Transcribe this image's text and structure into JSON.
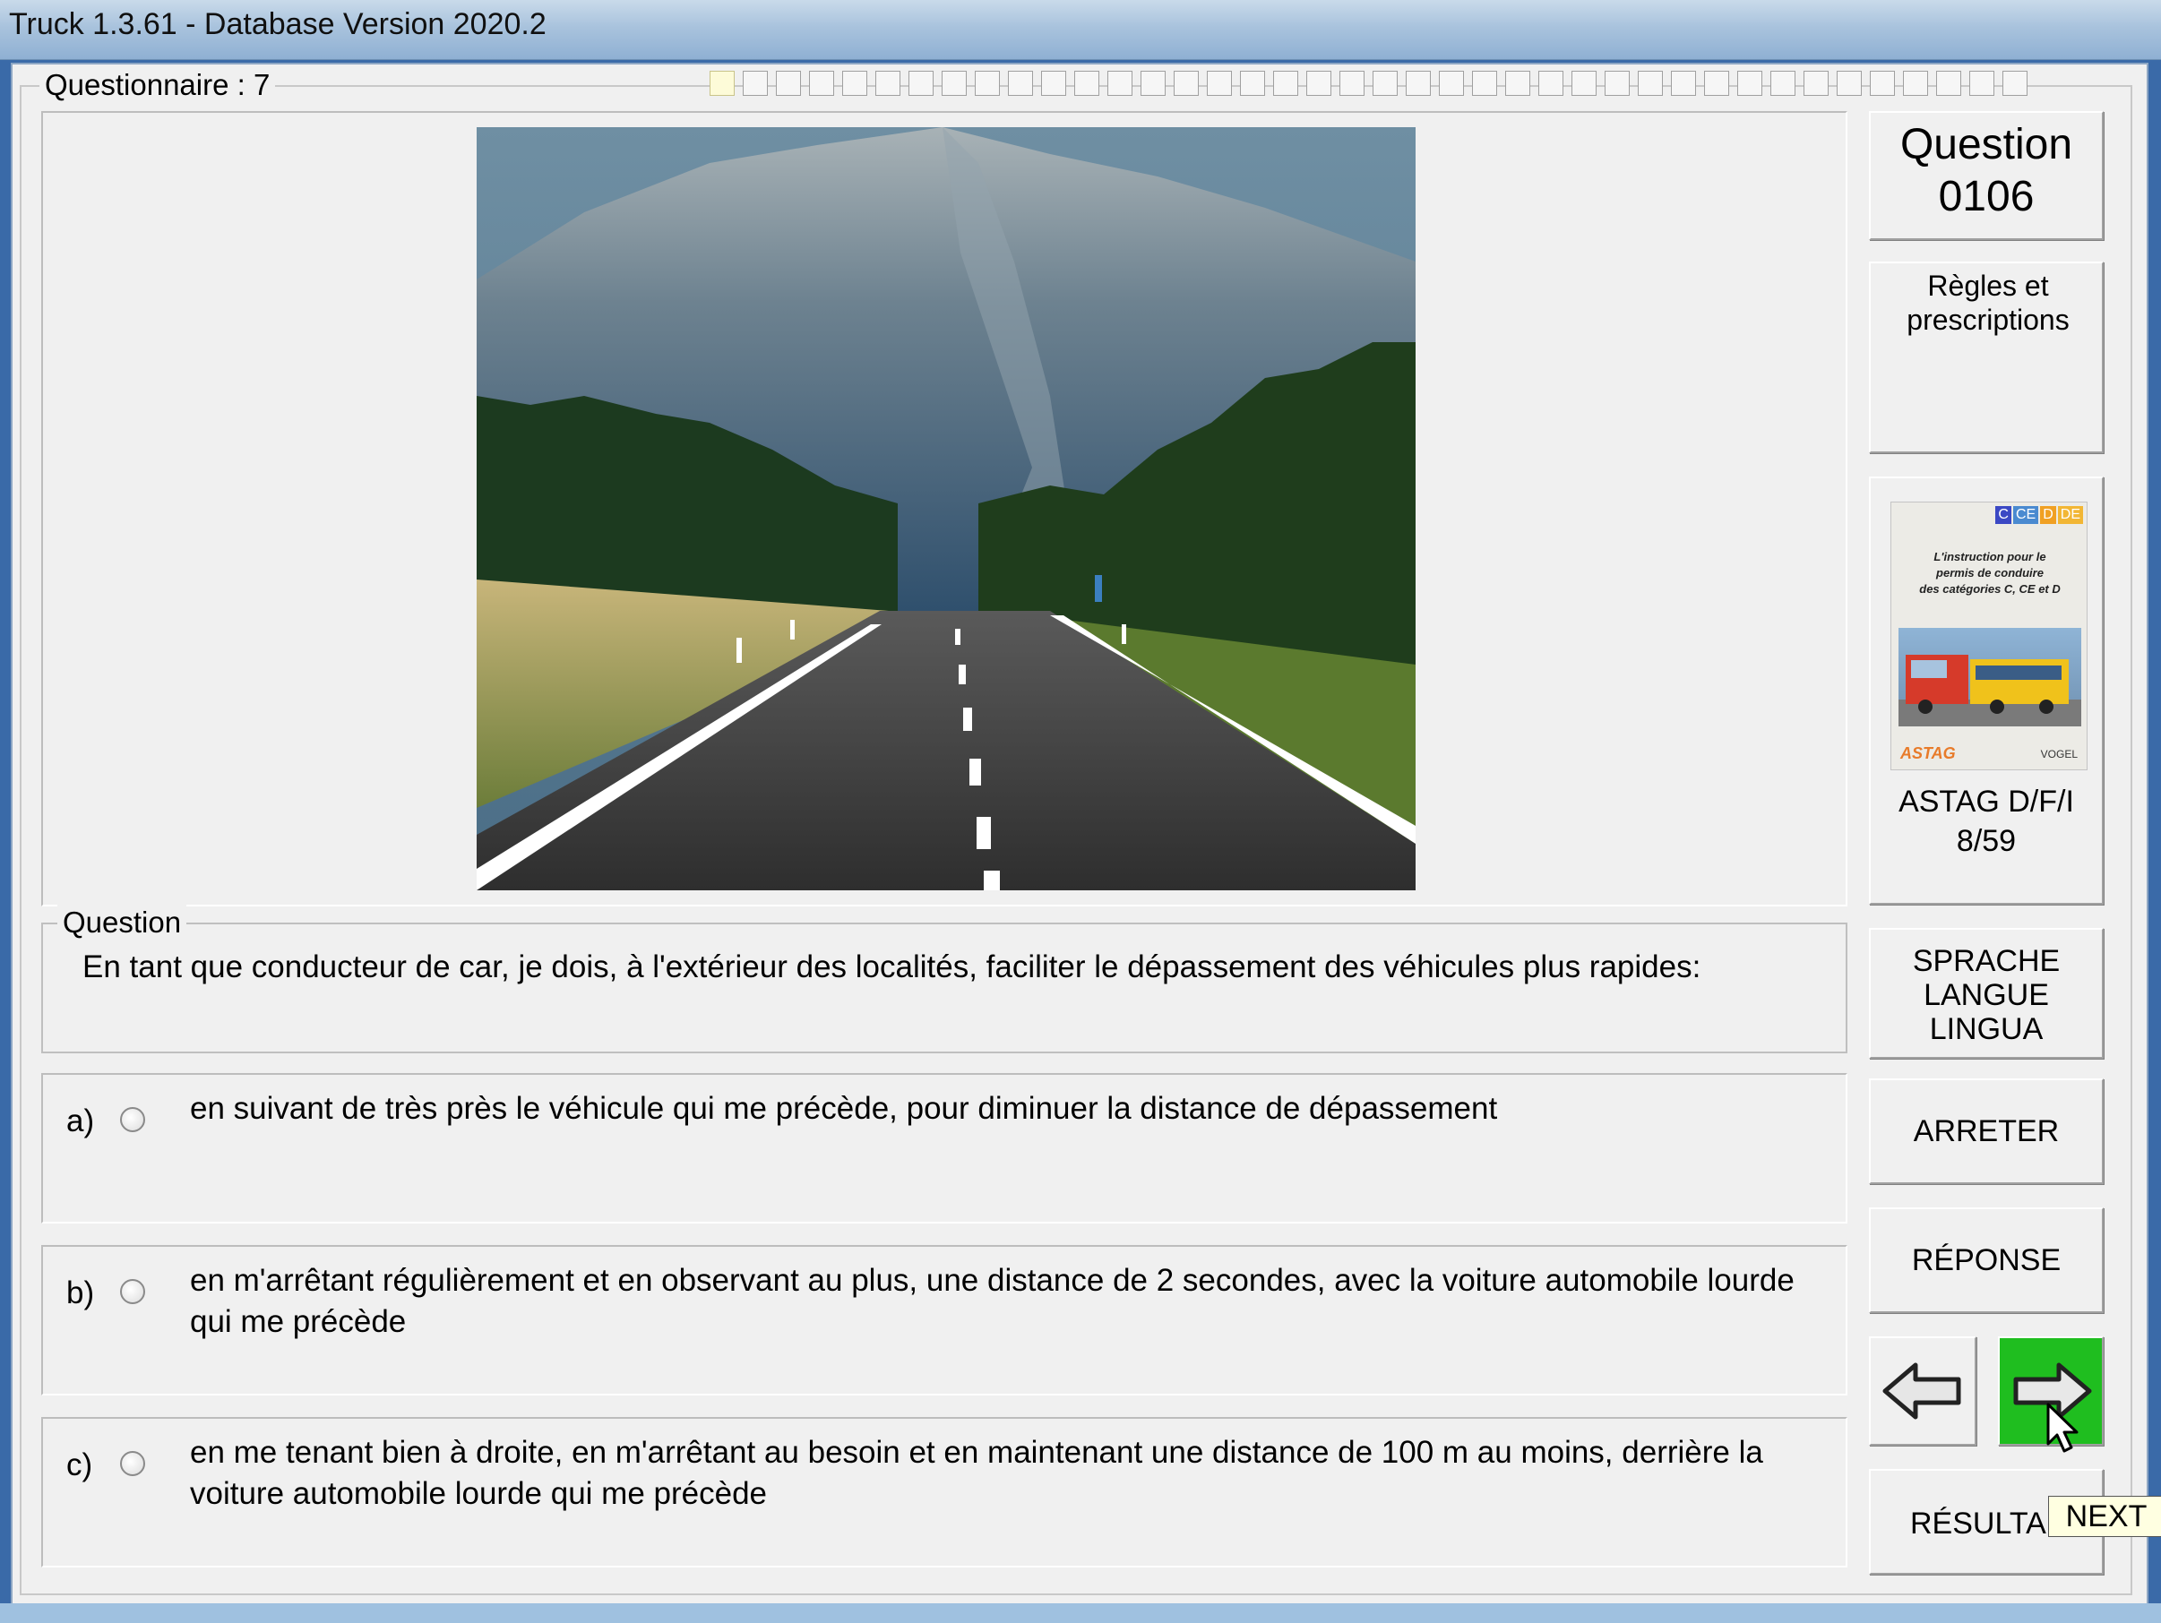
{
  "window": {
    "title": "Truck 1.3.61 - Database Version 2020.2"
  },
  "questionnaire": {
    "legend": "Questionnaire : 7",
    "progress_cells": 40,
    "current_cell": 0
  },
  "question_panel": {
    "number_label": "Question",
    "number": "0106",
    "category": "Règles et prescriptions"
  },
  "book": {
    "badges": [
      "C",
      "CE",
      "D",
      "DE"
    ],
    "caption_lines": [
      "L'instruction pour le",
      "permis de conduire",
      "des catégories C, CE et D"
    ],
    "publisher": "ASTAG",
    "brand": "VOGEL",
    "reference_line1": "ASTAG D/F/I",
    "reference_line2": "8/59"
  },
  "question": {
    "legend": "Question",
    "text": "En tant que conducteur de car, je dois, à l'extérieur des localités, faciliter le dépassement des véhicules plus rapides:"
  },
  "answers": [
    {
      "letter": "a)",
      "text": "en suivant de très près le véhicule qui me précède, pour diminuer la distance de dépassement"
    },
    {
      "letter": "b)",
      "text": "en m'arrêtant régulièrement et en observant au plus, une distance de 2 secondes, avec la voiture automobile lourde qui me précède"
    },
    {
      "letter": "c)",
      "text": "en me tenant bien à droite, en m'arrêtant au besoin et en maintenant une distance de 100 m au moins, derrière la voiture automobile lourde qui me précède"
    }
  ],
  "buttons": {
    "language_line1": "SPRACHE",
    "language_line2": "LANGUE",
    "language_line3": "LINGUA",
    "stop": "ARRETER",
    "answer": "RÉPONSE",
    "results": "RÉSULTA",
    "prev_icon": "arrow-left-icon",
    "next_icon": "arrow-right-icon"
  },
  "tooltip": "NEXT",
  "colors": {
    "next_button": "#1fbe1f",
    "titlebar": "#a9c3dd",
    "window_bg": "#f0f0f0"
  }
}
